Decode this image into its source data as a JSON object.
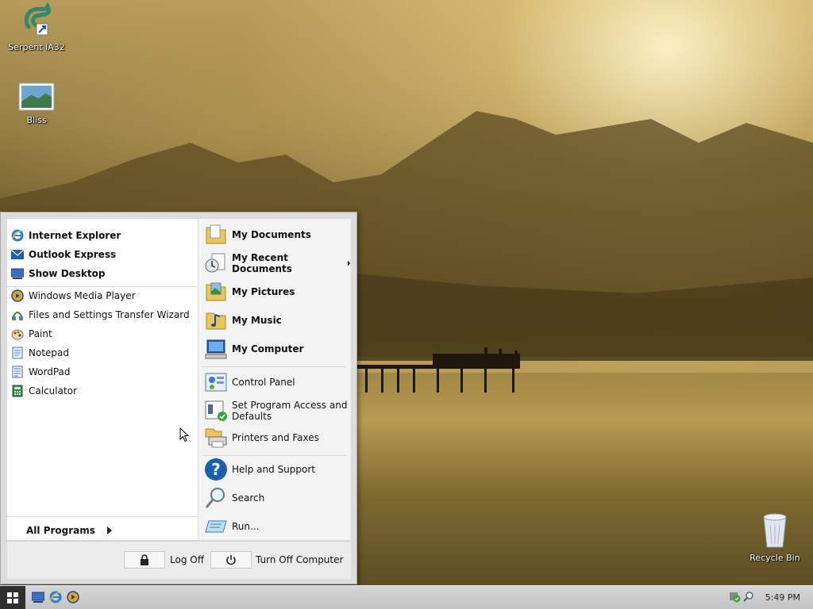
{
  "desktop": {
    "icons": [
      {
        "label": "Serpent IA32"
      },
      {
        "label": "Bliss"
      },
      {
        "label": "Recycle Bin"
      }
    ]
  },
  "start_menu": {
    "pinned": [
      {
        "label": "Internet Explorer",
        "icon": "internet-explorer-icon"
      },
      {
        "label": "Outlook Express",
        "icon": "outlook-express-icon"
      },
      {
        "label": "Show Desktop",
        "icon": "show-desktop-icon"
      }
    ],
    "recent": [
      {
        "label": "Windows Media Player",
        "icon": "media-player-icon"
      },
      {
        "label": "Files and Settings Transfer Wizard",
        "icon": "transfer-wizard-icon"
      },
      {
        "label": "Paint",
        "icon": "paint-icon"
      },
      {
        "label": "Notepad",
        "icon": "notepad-icon"
      },
      {
        "label": "WordPad",
        "icon": "wordpad-icon"
      },
      {
        "label": "Calculator",
        "icon": "calculator-icon"
      }
    ],
    "all_programs": "All Programs",
    "places": [
      {
        "label": "My Documents",
        "icon": "folder-documents-icon"
      },
      {
        "label": "My Recent Documents",
        "icon": "recent-documents-icon"
      },
      {
        "label": "My Pictures",
        "icon": "folder-pictures-icon"
      },
      {
        "label": "My Music",
        "icon": "folder-music-icon"
      },
      {
        "label": "My Computer",
        "icon": "computer-icon"
      }
    ],
    "system": [
      {
        "label": "Control Panel",
        "icon": "control-panel-icon"
      },
      {
        "label": "Set Program Access and Defaults",
        "icon": "program-defaults-icon"
      },
      {
        "label": "Printers and Faxes",
        "icon": "printer-icon"
      }
    ],
    "tools": [
      {
        "label": "Help and Support",
        "icon": "help-icon"
      },
      {
        "label": "Search",
        "icon": "search-icon"
      },
      {
        "label": "Run...",
        "icon": "run-icon"
      }
    ],
    "footer": {
      "log_off": "Log Off",
      "turn_off": "Turn Off Computer"
    }
  },
  "taskbar": {
    "clock": "5:49 PM"
  }
}
